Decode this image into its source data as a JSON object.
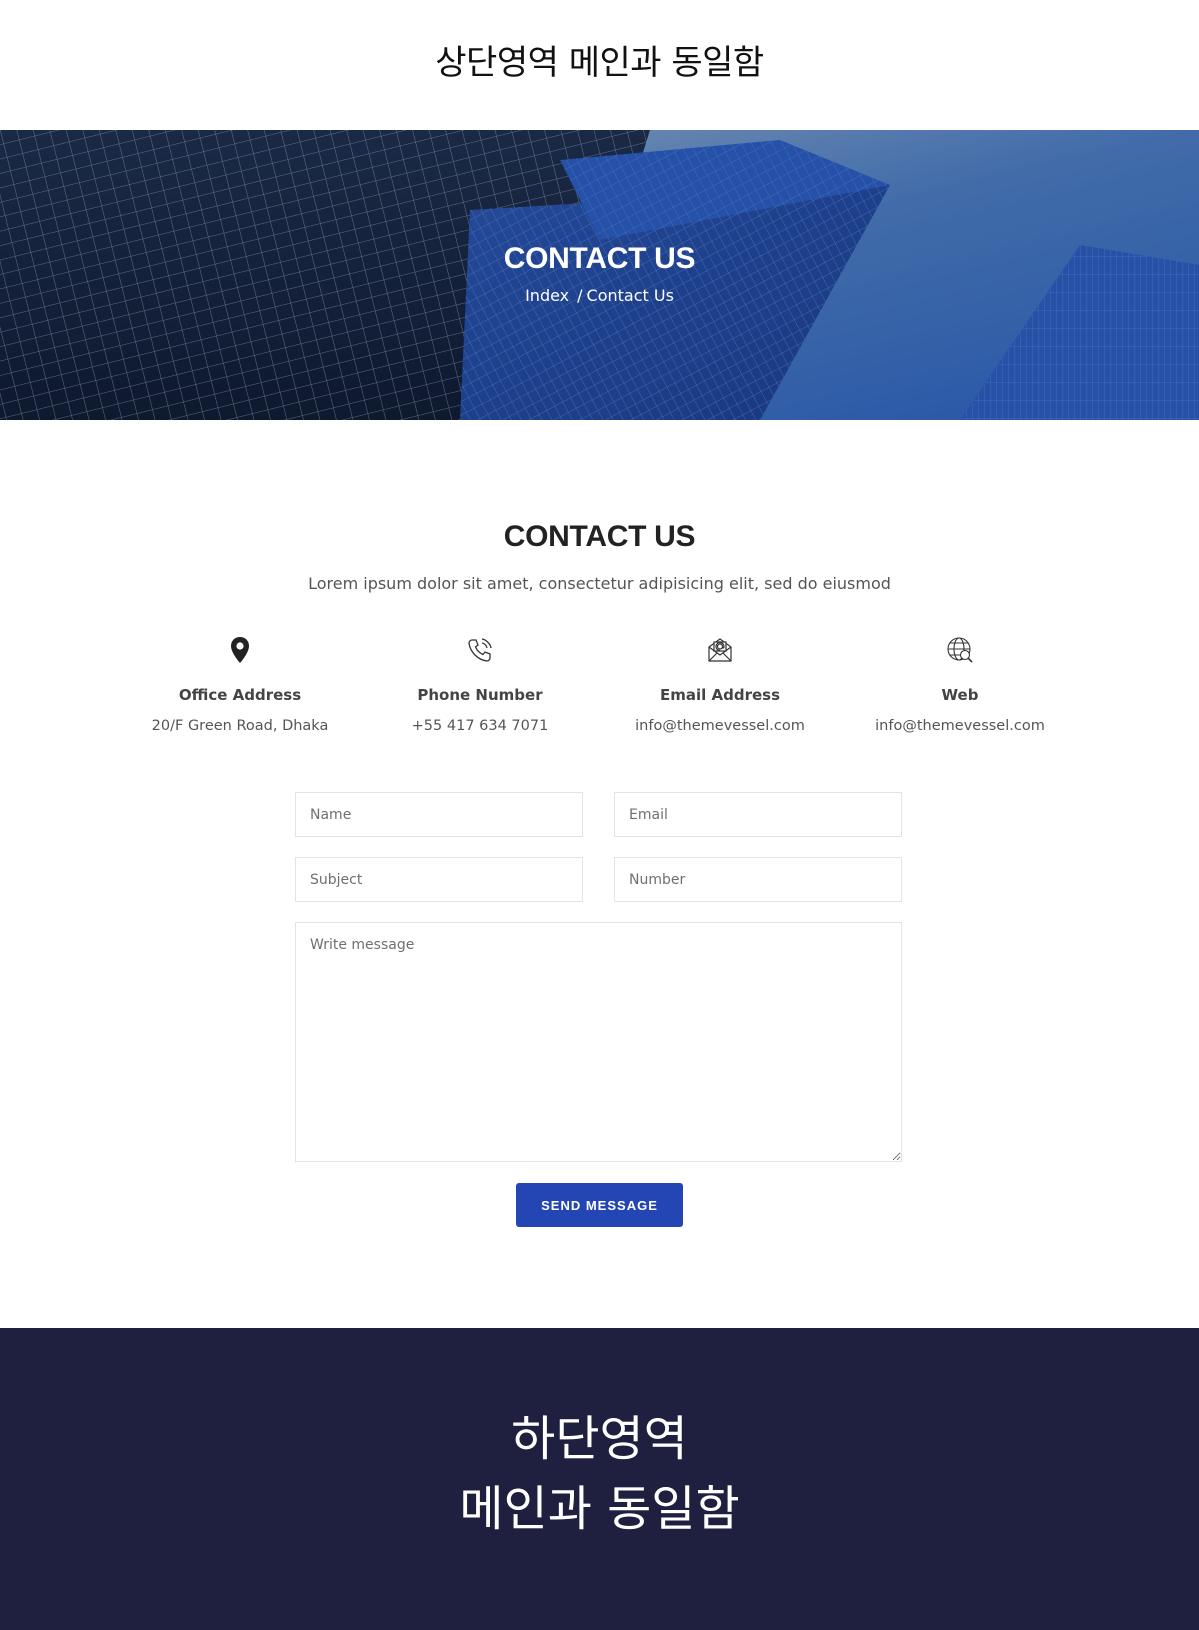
{
  "header": {
    "text": "상단영역 메인과 동일함"
  },
  "hero": {
    "title": "CONTACT US",
    "breadcrumb": {
      "home": "Index",
      "separator": "/",
      "current": "Contact Us"
    }
  },
  "section": {
    "title": "CONTACT US",
    "subtitle": "Lorem ipsum dolor sit amet, consectetur adipisicing elit, sed do eiusmod"
  },
  "info": [
    {
      "icon": "map-pin-icon",
      "label": "Office Address",
      "value": "20/F Green Road, Dhaka"
    },
    {
      "icon": "phone-icon",
      "label": "Phone Number",
      "value": "+55 417 634 7071"
    },
    {
      "icon": "envelope-icon",
      "label": "Email Address",
      "value": "info@themevessel.com"
    },
    {
      "icon": "globe-icon",
      "label": "Web",
      "value": "info@themevessel.com"
    }
  ],
  "form": {
    "name_placeholder": "Name",
    "email_placeholder": "Email",
    "subject_placeholder": "Subject",
    "number_placeholder": "Number",
    "message_placeholder": "Write message",
    "send_label": "SEND MESSAGE"
  },
  "footer": {
    "line1": "하단영역",
    "line2": "메인과 동일함"
  },
  "colors": {
    "accent": "#2446b4",
    "footer_bg": "#1f1f40",
    "hero_blue": "#2a5bbf"
  }
}
